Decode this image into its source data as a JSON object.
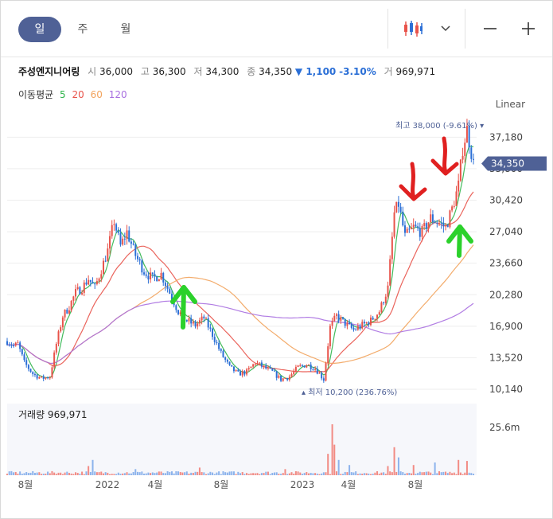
{
  "tabs": [
    {
      "label": "일",
      "active": true
    },
    {
      "label": "주",
      "active": false
    },
    {
      "label": "월",
      "active": false
    }
  ],
  "toolbar": {
    "chart_type_icon": "candlestick-icon",
    "dropdown_icon": "chevron-down-icon",
    "zoom_out_icon": "minus-icon",
    "zoom_in_icon": "plus-icon"
  },
  "stock": {
    "name": "주성엔지니어링",
    "open_label": "시",
    "open": "36,000",
    "high_label": "고",
    "high": "36,300",
    "low_label": "저",
    "low": "34,300",
    "close_label": "종",
    "close": "34,350",
    "change": "▼ 1,100",
    "change_pct": "-3.10%",
    "volume_label": "거",
    "volume": "969,971"
  },
  "moving_average": {
    "label": "이동평균",
    "periods": [
      {
        "value": "5",
        "color": "#2fb44b"
      },
      {
        "value": "20",
        "color": "#e8534a"
      },
      {
        "value": "60",
        "color": "#f2a35c"
      },
      {
        "value": "120",
        "color": "#a86fe0"
      }
    ]
  },
  "colors": {
    "up": "#e8534a",
    "down": "#2b6fd6",
    "accent": "#4f6196",
    "ma5": "#2fb44b",
    "ma20": "#e8534a",
    "ma60": "#f2a35c",
    "ma120": "#a86fe0",
    "annotation_red": "#e02020",
    "annotation_green": "#2bd12b"
  },
  "chart_data": {
    "type": "candlestick",
    "scale": "Linear",
    "y_ticks": [
      37180,
      33800,
      30420,
      27040,
      23660,
      20280,
      16900,
      13520,
      10140
    ],
    "y_tick_labels": [
      "37,180",
      "33,800",
      "30,420",
      "27,040",
      "23,660",
      "20,280",
      "16,900",
      "13,520",
      "10,140"
    ],
    "x_ticks": [
      "8월",
      "2022",
      "4월",
      "8월",
      "2023",
      "4월",
      "8월"
    ],
    "current_price": "34,350",
    "max_label": "최고 38,000 (-9.61%)",
    "max_value": 38000,
    "min_label": "최저 10,200 (236.76%)",
    "min_value": 10200,
    "price_path": [
      [
        0,
        15300
      ],
      [
        3,
        14800
      ],
      [
        5,
        15000
      ],
      [
        8,
        13000
      ],
      [
        12,
        11800
      ],
      [
        16,
        11300
      ],
      [
        20,
        11500
      ],
      [
        23,
        15000
      ],
      [
        26,
        18000
      ],
      [
        29,
        19000
      ],
      [
        32,
        20500
      ],
      [
        35,
        21000
      ],
      [
        38,
        22000
      ],
      [
        41,
        21000
      ],
      [
        44,
        23000
      ],
      [
        47,
        25000
      ],
      [
        50,
        28200
      ],
      [
        53,
        25500
      ],
      [
        56,
        27000
      ],
      [
        60,
        24500
      ],
      [
        64,
        22800
      ],
      [
        68,
        22000
      ],
      [
        72,
        22500
      ],
      [
        76,
        20500
      ],
      [
        80,
        18500
      ],
      [
        84,
        17500
      ],
      [
        88,
        17000
      ],
      [
        92,
        17800
      ],
      [
        96,
        16000
      ],
      [
        100,
        14000
      ],
      [
        104,
        12500
      ],
      [
        108,
        11800
      ],
      [
        112,
        12000
      ],
      [
        116,
        13000
      ],
      [
        120,
        12500
      ],
      [
        124,
        12000
      ],
      [
        128,
        11200
      ],
      [
        132,
        11500
      ],
      [
        136,
        12500
      ],
      [
        140,
        12800
      ],
      [
        144,
        12400
      ],
      [
        148,
        11200
      ],
      [
        151,
        16800
      ],
      [
        154,
        18000
      ],
      [
        158,
        17200
      ],
      [
        162,
        16500
      ],
      [
        166,
        17000
      ],
      [
        170,
        17500
      ],
      [
        174,
        18500
      ],
      [
        178,
        21000
      ],
      [
        181,
        29000
      ],
      [
        183,
        30000
      ],
      [
        186,
        26500
      ],
      [
        190,
        27500
      ],
      [
        194,
        27000
      ],
      [
        198,
        28500
      ],
      [
        202,
        28000
      ],
      [
        205,
        27500
      ],
      [
        208,
        29500
      ],
      [
        211,
        32000
      ],
      [
        213,
        36000
      ],
      [
        215,
        38000
      ],
      [
        218,
        34350
      ]
    ],
    "volume_label": "거래량 969,971",
    "volume_axis_label": "25.6m",
    "volume_spikes": [
      [
        38,
        0.18
      ],
      [
        40,
        0.3
      ],
      [
        60,
        0.12
      ],
      [
        90,
        0.15
      ],
      [
        130,
        0.12
      ],
      [
        150,
        0.42
      ],
      [
        152,
        1.0
      ],
      [
        153,
        0.6
      ],
      [
        155,
        0.3
      ],
      [
        160,
        0.2
      ],
      [
        178,
        0.18
      ],
      [
        181,
        0.55
      ],
      [
        183,
        0.35
      ],
      [
        190,
        0.2
      ],
      [
        200,
        0.25
      ],
      [
        211,
        0.3
      ],
      [
        215,
        0.28
      ]
    ]
  }
}
